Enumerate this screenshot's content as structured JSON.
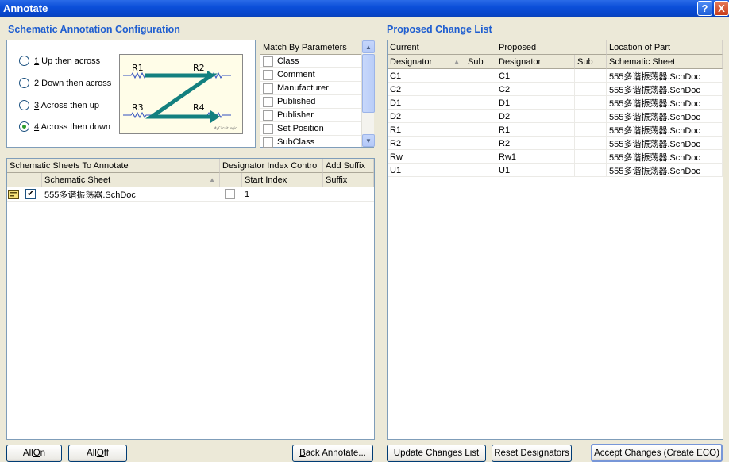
{
  "window": {
    "title": "Annotate",
    "help_label": "?",
    "close_label": "X"
  },
  "config": {
    "title": "Schematic Annotation Configuration",
    "options": [
      {
        "key": "1",
        "label": " Up then across",
        "checked": false
      },
      {
        "key": "2",
        "label": " Down then across",
        "checked": false
      },
      {
        "key": "3",
        "label": " Across then up",
        "checked": false
      },
      {
        "key": "4",
        "label": " Across then down",
        "checked": true
      }
    ],
    "diagram": {
      "labels": [
        "R1",
        "R2",
        "R3",
        "R4"
      ],
      "brand": "MyCircuitLogic",
      "arrow_color": "#13807f"
    }
  },
  "match": {
    "header": "Match By Parameters",
    "items": [
      "Class",
      "Comment",
      "Manufacturer",
      "Published",
      "Publisher",
      "Set Position",
      "SubClass"
    ]
  },
  "sheets": {
    "header_group": "Schematic Sheets To Annotate",
    "header_index": "Designator Index Control",
    "header_suffix": "Add Suffix",
    "col_sheet": "Schematic Sheet",
    "col_start": "Start Index",
    "col_suffix": "Suffix",
    "rows": [
      {
        "sheet": "555多谐振荡器.SchDoc",
        "start_index": "1",
        "suffix": ""
      }
    ]
  },
  "changes": {
    "title": "Proposed Change List",
    "group_current": "Current",
    "group_proposed": "Proposed",
    "group_location": "Location of Part",
    "col_designator": "Designator",
    "col_sub": "Sub",
    "col_designator2": "Designator",
    "col_sub2": "Sub",
    "col_sheet": "Schematic Sheet",
    "rows": [
      {
        "current": "C1",
        "proposed": "C1",
        "sheet": "555多谐振荡器.SchDoc"
      },
      {
        "current": "C2",
        "proposed": "C2",
        "sheet": "555多谐振荡器.SchDoc"
      },
      {
        "current": "D1",
        "proposed": "D1",
        "sheet": "555多谐振荡器.SchDoc"
      },
      {
        "current": "D2",
        "proposed": "D2",
        "sheet": "555多谐振荡器.SchDoc"
      },
      {
        "current": "R1",
        "proposed": "R1",
        "sheet": "555多谐振荡器.SchDoc"
      },
      {
        "current": "R2",
        "proposed": "R2",
        "sheet": "555多谐振荡器.SchDoc"
      },
      {
        "current": "Rw",
        "proposed": "Rw1",
        "sheet": "555多谐振荡器.SchDoc"
      },
      {
        "current": "U1",
        "proposed": "U1",
        "sheet": "555多谐振荡器.SchDoc"
      }
    ]
  },
  "buttons": {
    "all_on": {
      "pre": "All ",
      "key": "O",
      "post": "n"
    },
    "all_off": {
      "pre": "All ",
      "key": "O",
      "post": "ff"
    },
    "back_annotate": {
      "pre": "",
      "key": "B",
      "post": "ack Annotate..."
    },
    "update": "Update Changes List",
    "reset": "Reset Designators",
    "accept": "Accept Changes (Create ECO)"
  }
}
